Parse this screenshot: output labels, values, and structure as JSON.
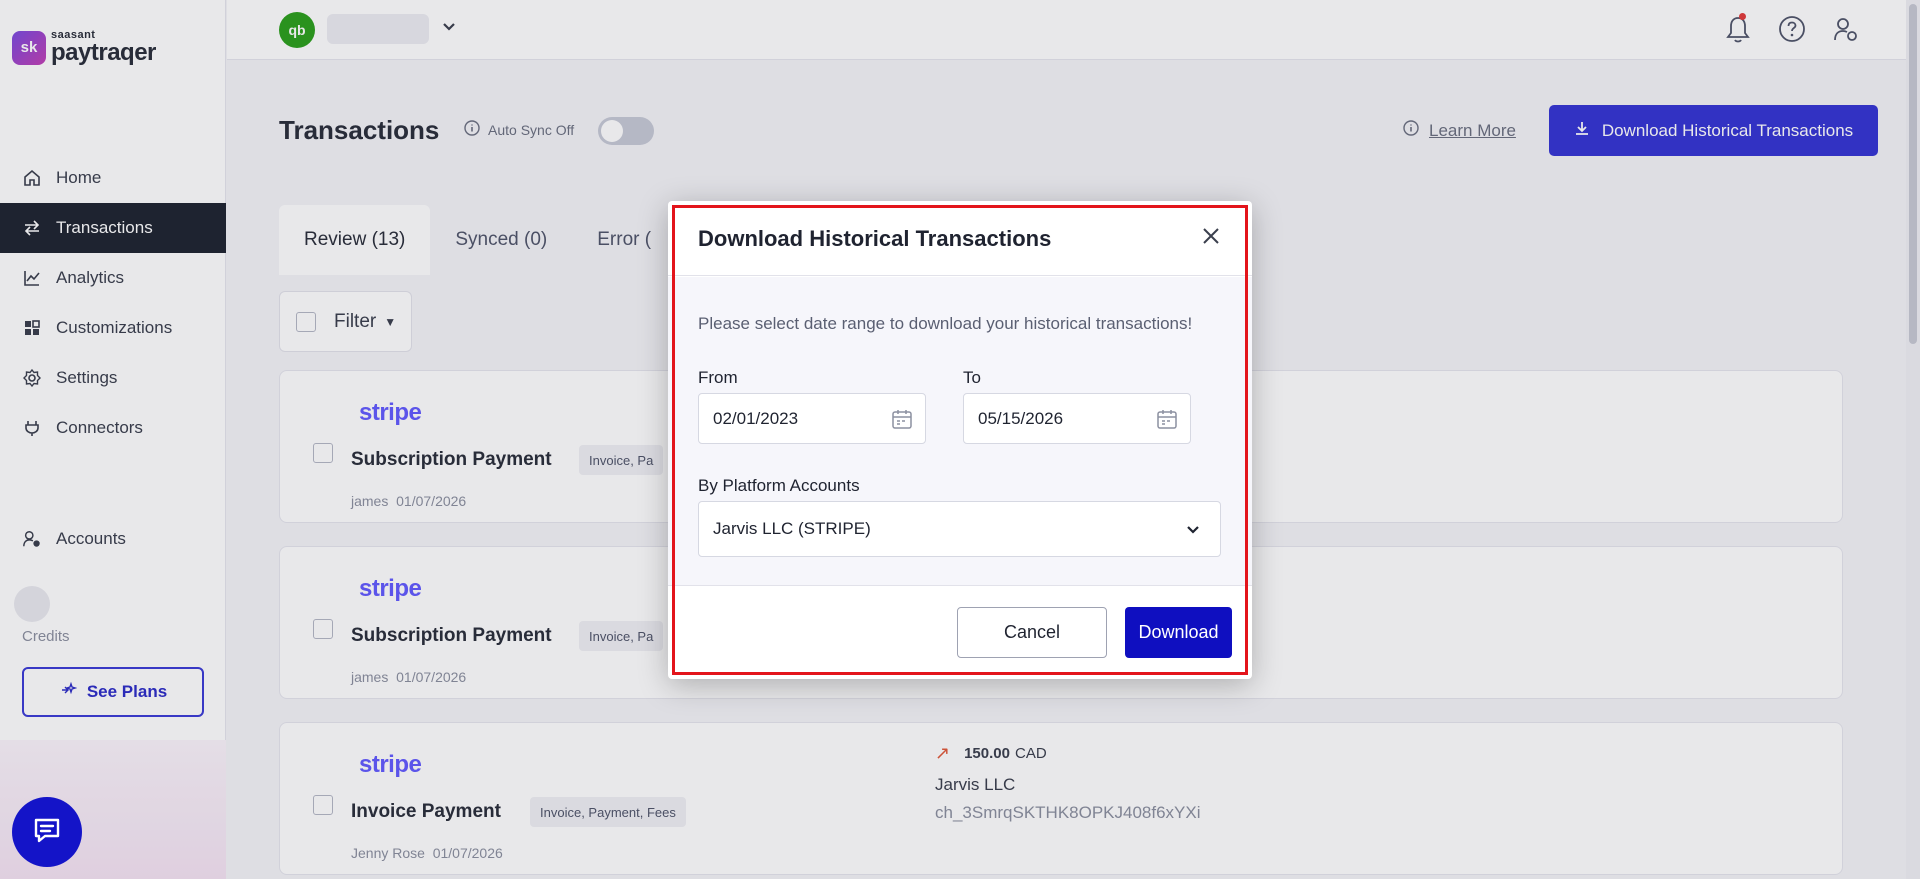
{
  "brand": {
    "badge": "sk",
    "small": "saasant",
    "name": "paytraqer"
  },
  "sidebar": {
    "items": [
      {
        "label": "Home",
        "icon": "home-icon"
      },
      {
        "label": "Transactions",
        "icon": "transfer-icon"
      },
      {
        "label": "Analytics",
        "icon": "chart-icon"
      },
      {
        "label": "Customizations",
        "icon": "grid-icon"
      },
      {
        "label": "Settings",
        "icon": "gear-icon"
      },
      {
        "label": "Connectors",
        "icon": "plug-icon"
      }
    ],
    "accounts_label": "Accounts",
    "credits_label": "Credits",
    "see_plans_label": "See Plans"
  },
  "topbar": {
    "qb_badge": "qb"
  },
  "page": {
    "title": "Transactions",
    "auto_sync_label": "Auto Sync Off",
    "learn_more_label": "Learn More",
    "download_hist_label": "Download Historical Transactions"
  },
  "tabs": [
    {
      "label": "Review (13)"
    },
    {
      "label": "Synced (0)"
    },
    {
      "label": "Error ("
    }
  ],
  "filter": {
    "label": "Filter"
  },
  "cards": [
    {
      "brand": "stripe",
      "title": "Subscription Payment",
      "tag": "Invoice, Pa",
      "user": "james",
      "date": "01/07/2026"
    },
    {
      "brand": "stripe",
      "title": "Subscription Payment",
      "tag": "Invoice, Pa",
      "user": "james",
      "date": "01/07/2026"
    },
    {
      "brand": "stripe",
      "title": "Invoice Payment",
      "tag": "Invoice, Payment, Fees",
      "user": "Jenny Rose",
      "date": "01/07/2026",
      "amount": "150.00",
      "currency": "CAD",
      "payee": "Jarvis LLC",
      "charge_id": "ch_3SmrqSKTHK8OPKJ408f6xYXi"
    }
  ],
  "modal": {
    "title": "Download Historical Transactions",
    "description": "Please select date range to download your historical transactions!",
    "from_label": "From",
    "from_value": "02/01/2023",
    "to_label": "To",
    "to_value": "05/15/2026",
    "accounts_label": "By Platform Accounts",
    "account_value": "Jarvis LLC (STRIPE)",
    "cancel_label": "Cancel",
    "download_label": "Download"
  },
  "colors": {
    "accent": "#3535d4",
    "primary_button": "#0f0fc0",
    "highlight": "#e3141b",
    "stripe": "#635bff",
    "quickbooks": "#2ca01c"
  }
}
